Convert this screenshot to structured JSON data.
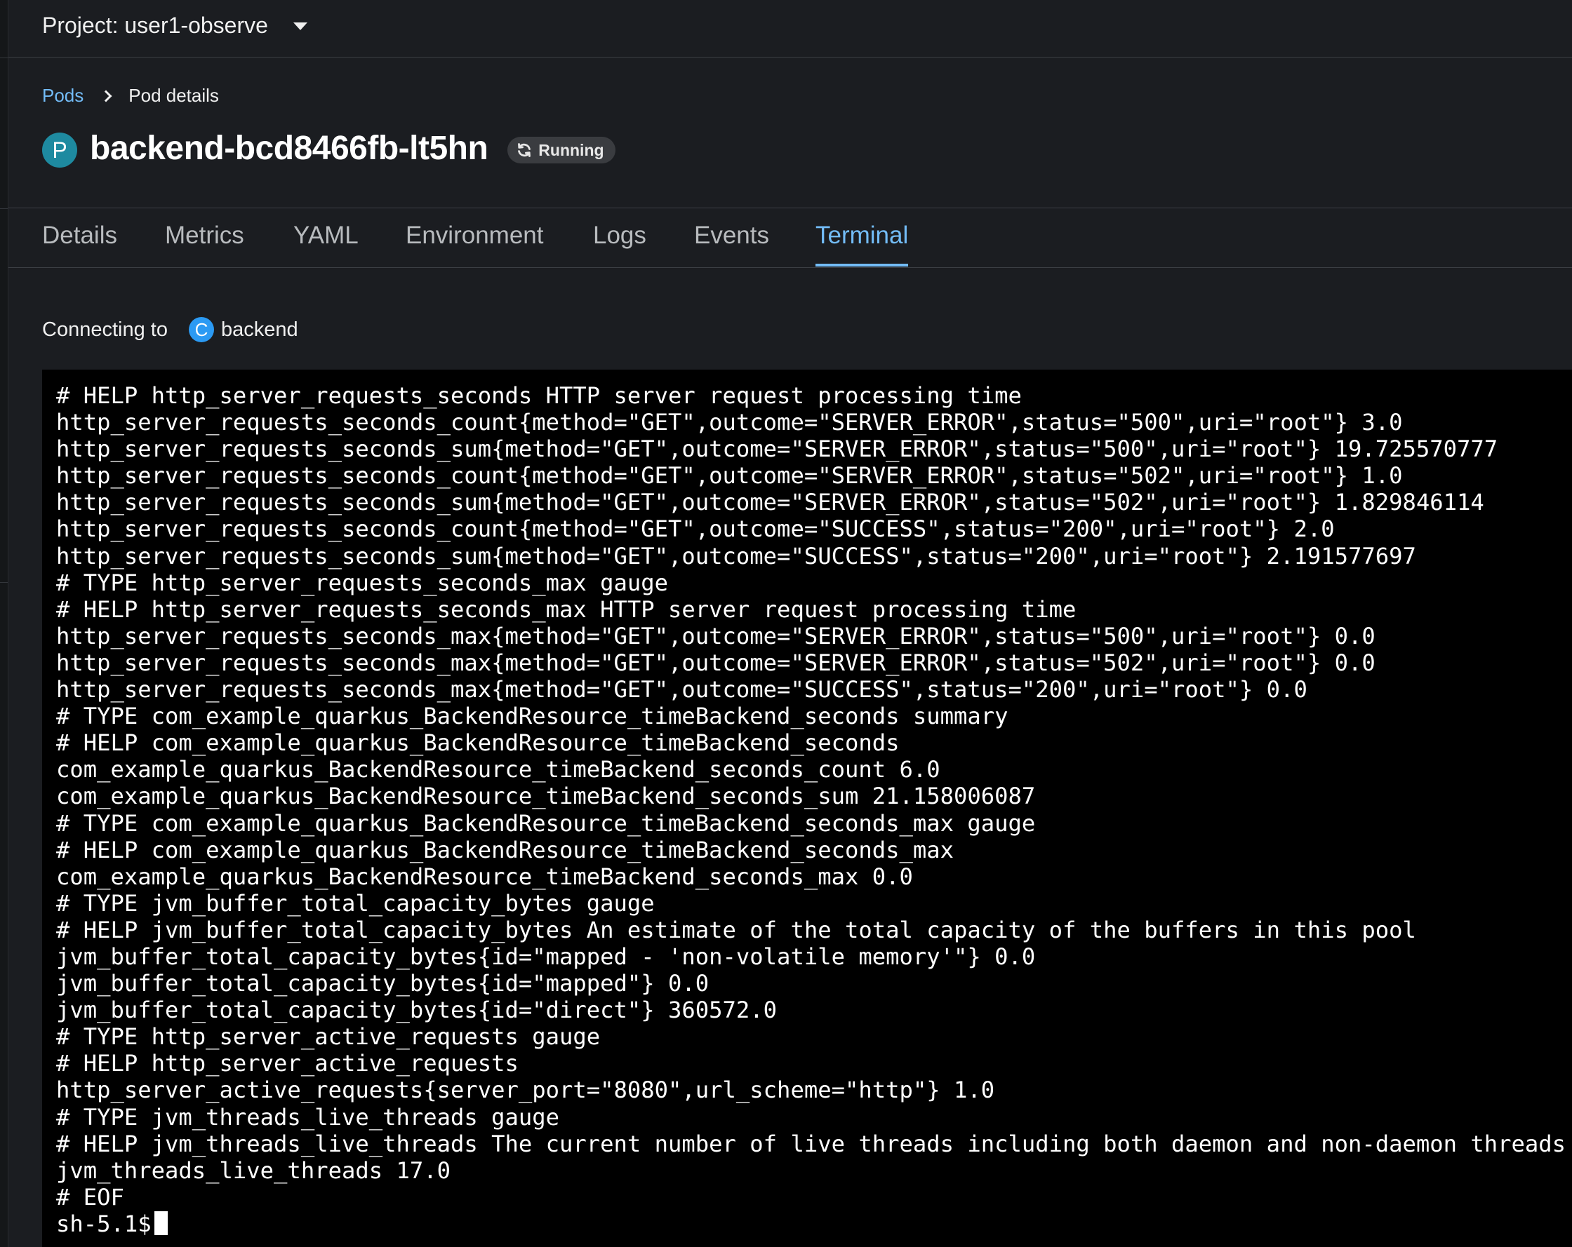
{
  "project": {
    "label": "Project: user1-observe"
  },
  "breadcrumb": {
    "parent": "Pods",
    "current": "Pod details"
  },
  "pod": {
    "badge": "P",
    "name": "backend-bcd8466fb-lt5hn",
    "status": "Running",
    "status_icon": "sync-icon"
  },
  "tabs": [
    {
      "label": "Details",
      "active": false
    },
    {
      "label": "Metrics",
      "active": false
    },
    {
      "label": "YAML",
      "active": false
    },
    {
      "label": "Environment",
      "active": false
    },
    {
      "label": "Logs",
      "active": false
    },
    {
      "label": "Events",
      "active": false
    },
    {
      "label": "Terminal",
      "active": true
    }
  ],
  "connecting": {
    "label": "Connecting to",
    "container_badge": "C",
    "container": "backend"
  },
  "terminal": {
    "lines": [
      "# HELP http_server_requests_seconds HTTP server request processing time",
      "http_server_requests_seconds_count{method=\"GET\",outcome=\"SERVER_ERROR\",status=\"500\",uri=\"root\"} 3.0",
      "http_server_requests_seconds_sum{method=\"GET\",outcome=\"SERVER_ERROR\",status=\"500\",uri=\"root\"} 19.725570777",
      "http_server_requests_seconds_count{method=\"GET\",outcome=\"SERVER_ERROR\",status=\"502\",uri=\"root\"} 1.0",
      "http_server_requests_seconds_sum{method=\"GET\",outcome=\"SERVER_ERROR\",status=\"502\",uri=\"root\"} 1.829846114",
      "http_server_requests_seconds_count{method=\"GET\",outcome=\"SUCCESS\",status=\"200\",uri=\"root\"} 2.0",
      "http_server_requests_seconds_sum{method=\"GET\",outcome=\"SUCCESS\",status=\"200\",uri=\"root\"} 2.191577697",
      "# TYPE http_server_requests_seconds_max gauge",
      "# HELP http_server_requests_seconds_max HTTP server request processing time",
      "http_server_requests_seconds_max{method=\"GET\",outcome=\"SERVER_ERROR\",status=\"500\",uri=\"root\"} 0.0",
      "http_server_requests_seconds_max{method=\"GET\",outcome=\"SERVER_ERROR\",status=\"502\",uri=\"root\"} 0.0",
      "http_server_requests_seconds_max{method=\"GET\",outcome=\"SUCCESS\",status=\"200\",uri=\"root\"} 0.0",
      "# TYPE com_example_quarkus_BackendResource_timeBackend_seconds summary",
      "# HELP com_example_quarkus_BackendResource_timeBackend_seconds",
      "com_example_quarkus_BackendResource_timeBackend_seconds_count 6.0",
      "com_example_quarkus_BackendResource_timeBackend_seconds_sum 21.158006087",
      "# TYPE com_example_quarkus_BackendResource_timeBackend_seconds_max gauge",
      "# HELP com_example_quarkus_BackendResource_timeBackend_seconds_max",
      "com_example_quarkus_BackendResource_timeBackend_seconds_max 0.0",
      "# TYPE jvm_buffer_total_capacity_bytes gauge",
      "# HELP jvm_buffer_total_capacity_bytes An estimate of the total capacity of the buffers in this pool",
      "jvm_buffer_total_capacity_bytes{id=\"mapped - 'non-volatile memory'\"} 0.0",
      "jvm_buffer_total_capacity_bytes{id=\"mapped\"} 0.0",
      "jvm_buffer_total_capacity_bytes{id=\"direct\"} 360572.0",
      "# TYPE http_server_active_requests gauge",
      "# HELP http_server_active_requests",
      "http_server_active_requests{server_port=\"8080\",url_scheme=\"http\"} 1.0",
      "# TYPE jvm_threads_live_threads gauge",
      "# HELP jvm_threads_live_threads The current number of live threads including both daemon and non-daemon threads",
      "jvm_threads_live_threads 17.0",
      "# EOF"
    ],
    "prompt": "sh-5.1$"
  },
  "colors": {
    "background": "#1b1d21",
    "accent": "#73bcf7",
    "pod_badge": "#1e8aa0",
    "container_badge": "#2b9af3",
    "terminal_bg": "#000000"
  }
}
